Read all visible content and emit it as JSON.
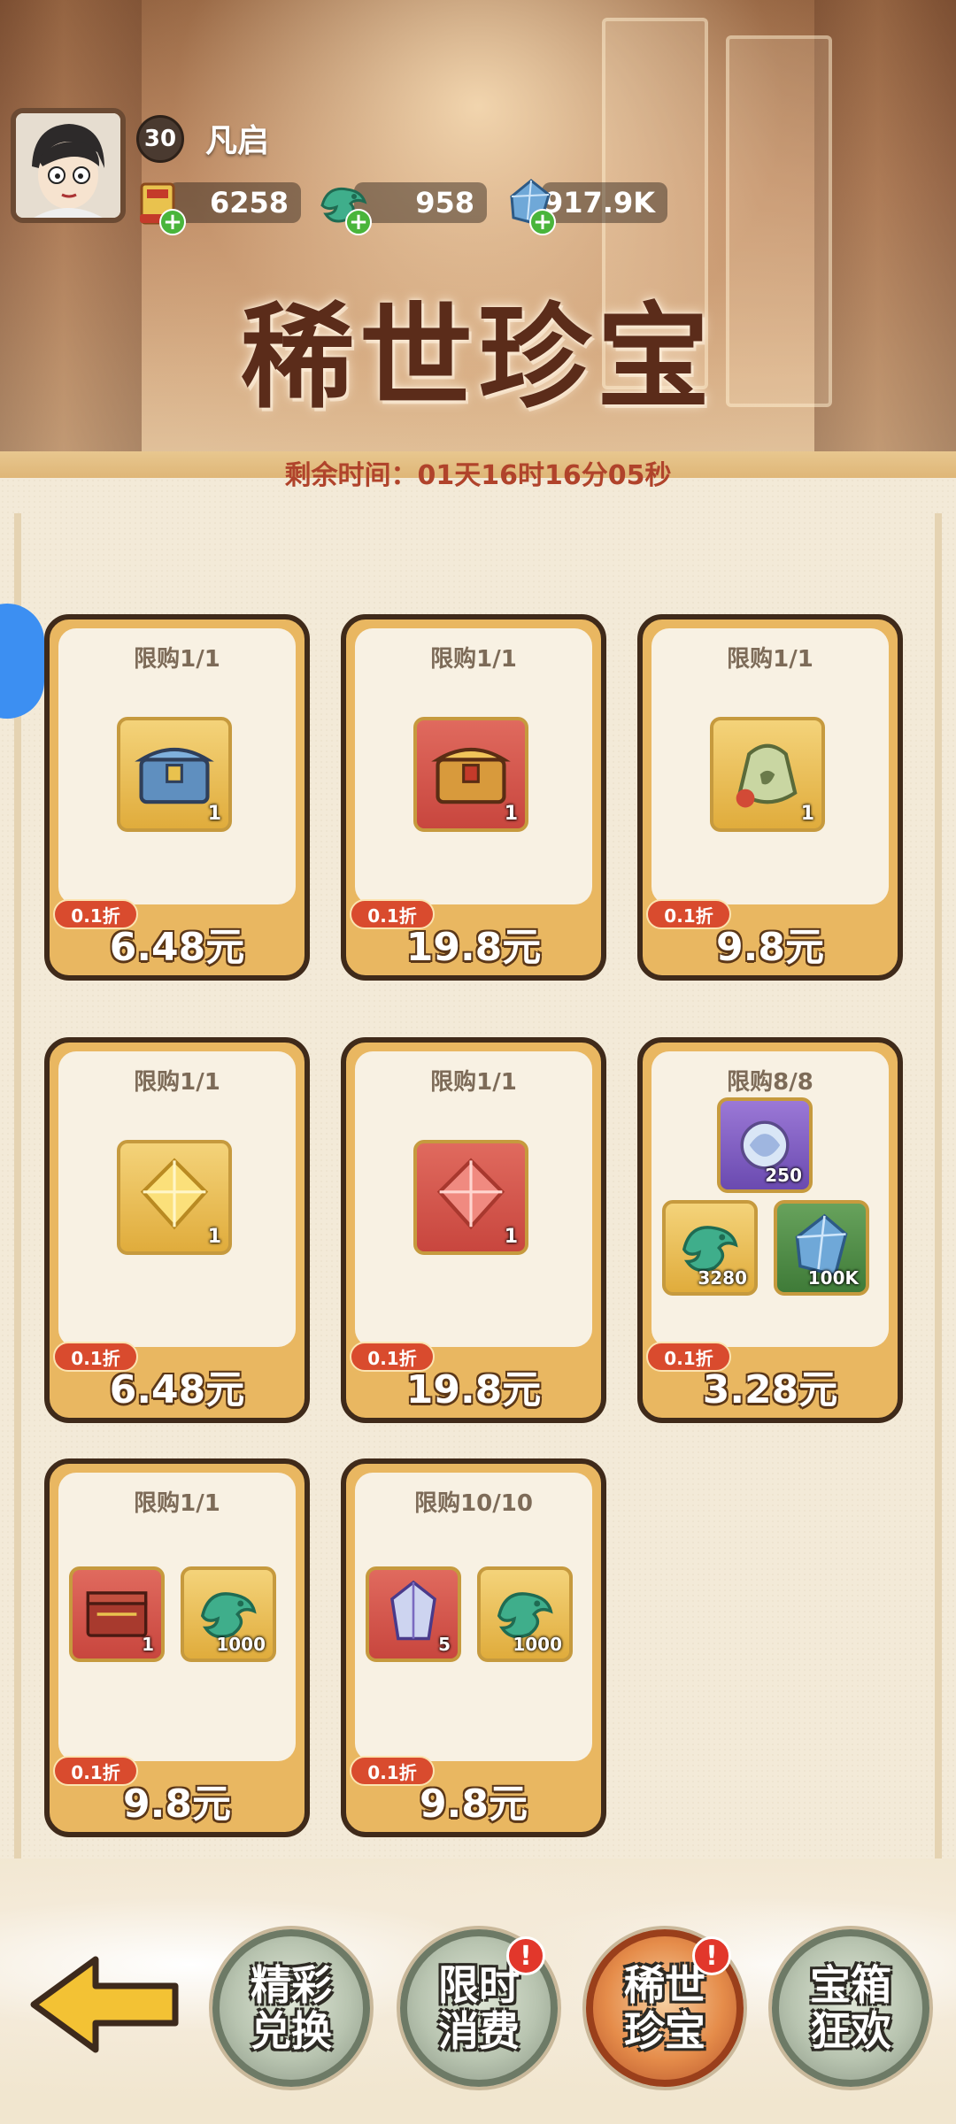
{
  "player": {
    "level": "30",
    "name": "凡启"
  },
  "resources": [
    {
      "icon": "scroll-ticket-icon",
      "value": "6258"
    },
    {
      "icon": "jade-dragon-icon",
      "value": "958"
    },
    {
      "icon": "crystal-icon",
      "value": "917.9K"
    }
  ],
  "title": "稀世珍宝",
  "countdown": "剩余时间：01天16时16分05秒",
  "cards": [
    {
      "limit": "限购1/1",
      "discount": "0.1折",
      "price": "6.48元",
      "items": [
        {
          "icon": "blue-chest-icon",
          "qty": "1",
          "bg": "gold"
        }
      ]
    },
    {
      "limit": "限购1/1",
      "discount": "0.1折",
      "price": "19.8元",
      "items": [
        {
          "icon": "gold-chest-icon",
          "qty": "1",
          "bg": "red"
        }
      ]
    },
    {
      "limit": "限购1/1",
      "discount": "0.1折",
      "price": "9.8元",
      "items": [
        {
          "icon": "pouch-icon",
          "qty": "1",
          "bg": "gold"
        }
      ]
    },
    {
      "limit": "限购1/1",
      "discount": "0.1折",
      "price": "6.48元",
      "items": [
        {
          "icon": "gold-gem-icon",
          "qty": "1",
          "bg": "gold"
        }
      ]
    },
    {
      "limit": "限购1/1",
      "discount": "0.1折",
      "price": "19.8元",
      "items": [
        {
          "icon": "red-gem-icon",
          "qty": "1",
          "bg": "red"
        }
      ]
    },
    {
      "limit": "限购8/8",
      "discount": "0.1折",
      "price": "3.28元",
      "items": [
        {
          "icon": "spirit-orb-icon",
          "qty": "250",
          "bg": "purple"
        },
        {
          "icon": "jade-dragon-icon",
          "qty": "3280",
          "bg": "gold"
        },
        {
          "icon": "crystal-icon",
          "qty": "100K",
          "bg": "green"
        }
      ]
    },
    {
      "limit": "限购1/1",
      "discount": "0.1折",
      "price": "9.8元",
      "items": [
        {
          "icon": "red-chest-icon",
          "qty": "1",
          "bg": "red"
        },
        {
          "icon": "jade-dragon-icon",
          "qty": "1000",
          "bg": "gold"
        }
      ]
    },
    {
      "limit": "限购10/10",
      "discount": "0.1折",
      "price": "9.8元",
      "items": [
        {
          "icon": "silver-gem-icon",
          "qty": "5",
          "bg": "red"
        },
        {
          "icon": "jade-dragon-icon",
          "qty": "1000",
          "bg": "gold"
        }
      ]
    }
  ],
  "nav": [
    {
      "label_line1": "精彩",
      "label_line2": "兑换",
      "badge": ""
    },
    {
      "label_line1": "限时",
      "label_line2": "消费",
      "badge": "!"
    },
    {
      "label_line1": "稀世",
      "label_line2": "珍宝",
      "badge": "!"
    },
    {
      "label_line1": "宝箱",
      "label_line2": "狂欢",
      "badge": ""
    }
  ],
  "colors": {
    "price_outline": "#5b3718",
    "discount_bg": "#d94b2e",
    "badge_red": "#e2372b",
    "title": "#5b2c1a"
  }
}
